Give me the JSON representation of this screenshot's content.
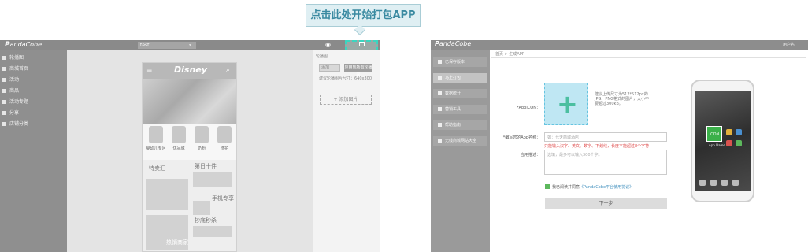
{
  "callout": {
    "text": "点击此处开始打包APP"
  },
  "left_app": {
    "logo_prefix": "P",
    "logo_text": "anda",
    "logo_suffix": "Cobe",
    "project_selector": "test",
    "sidebar": [
      {
        "label": "轮播图",
        "icon": "image-icon"
      },
      {
        "label": "商城首页",
        "icon": "home-icon"
      },
      {
        "label": "活动",
        "icon": "list-icon"
      },
      {
        "label": "商品",
        "icon": "cart-icon"
      },
      {
        "label": "活动专题",
        "icon": "gift-icon"
      },
      {
        "label": "分享",
        "icon": "share-icon"
      },
      {
        "label": "店铺分类",
        "icon": "grid-icon"
      }
    ],
    "phone": {
      "title": "Disney",
      "categories": [
        "婴幼儿专区",
        "优品城",
        "奶粉",
        "洗护"
      ],
      "promos": [
        "特卖汇",
        "第日十件",
        "手机专享",
        "抄底秒杀",
        "热销商家"
      ]
    },
    "props": {
      "label": "轮播图",
      "btn_secondary": "添加",
      "btn_primary": "应用到所有轮播图",
      "hint": "建议轮播图片尺寸：640x300",
      "add_image": "+ 添加图片"
    }
  },
  "right_app": {
    "logo_prefix": "P",
    "logo_text": "anda",
    "logo_suffix": "Cobe",
    "user": "用户名",
    "breadcrumb": "首页 > 生成APP",
    "sidebar": [
      {
        "label": "已保存版本",
        "icon": "folder-icon",
        "active": false
      },
      {
        "label": "马上打包",
        "icon": "package-icon",
        "active": true
      },
      {
        "label": "数据统计",
        "icon": "chart-icon",
        "active": false
      },
      {
        "label": "营销工具",
        "icon": "tool-icon",
        "active": false
      },
      {
        "label": "帮助指南",
        "icon": "help-icon",
        "active": false
      },
      {
        "label": "无线商城网站大全",
        "icon": "link-icon",
        "active": false
      }
    ],
    "form": {
      "icon_label": "*AppICON：",
      "icon_hint": "建议上传尺寸为512*512px的JPG、PNG格式的图片，大小不要超过300kb。",
      "name_label": "*编写您的App名称：",
      "name_placeholder": "如：七天商城酒店",
      "name_error": "只能输入汉字、英文、数字、下划线，长度不能超过8个字符",
      "desc_label": "应用描述：",
      "desc_placeholder": "选填，最多可以输入300个字。",
      "agree_text": "我已阅读并同意",
      "agree_link": "《PandaCobe平台使用协议》",
      "next_button": "下一步"
    },
    "phone": {
      "app_icon_label": "ICON",
      "app_name": "App Name"
    }
  }
}
